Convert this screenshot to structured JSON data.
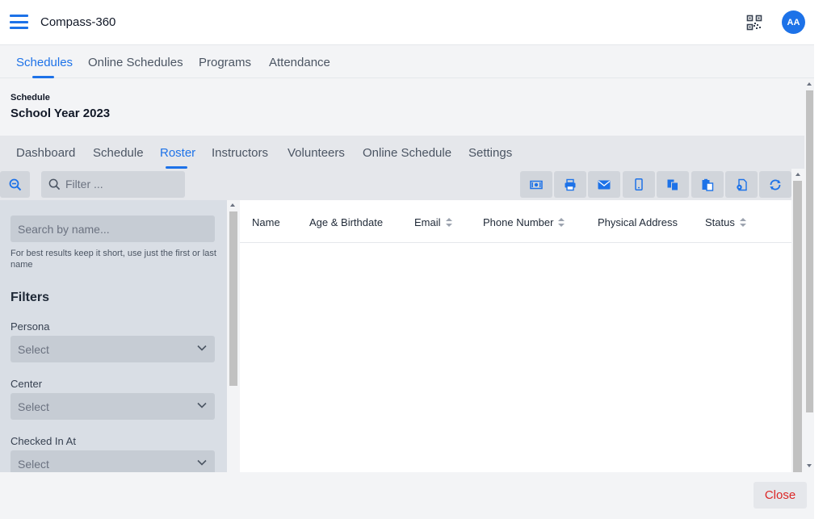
{
  "header": {
    "app_title": "Compass-360",
    "avatar_initials": "AA",
    "accent": "#1d72e8"
  },
  "top_tabs": [
    {
      "label": "Schedules",
      "active": true
    },
    {
      "label": "Online Schedules",
      "active": false
    },
    {
      "label": "Programs",
      "active": false
    },
    {
      "label": "Attendance",
      "active": false
    }
  ],
  "schedule": {
    "label": "Schedule",
    "name": "School Year 2023"
  },
  "sub_tabs": [
    {
      "label": "Dashboard",
      "active": false
    },
    {
      "label": "Schedule",
      "active": false
    },
    {
      "label": "Roster",
      "active": true
    },
    {
      "label": "Instructors",
      "active": false
    },
    {
      "label": "Volunteers",
      "active": false
    },
    {
      "label": "Online Schedule",
      "active": false
    },
    {
      "label": "Settings",
      "active": false
    }
  ],
  "toolbar": {
    "filter_placeholder": "Filter ...",
    "icons": [
      "money-icon",
      "print-icon",
      "email-icon",
      "mobile-icon",
      "copy-icon",
      "paste-icon",
      "file-settings-icon",
      "refresh-icon"
    ]
  },
  "left_panel": {
    "search_placeholder": "Search by name...",
    "search_hint": "For best results keep it short, use just the first or last name",
    "filters_heading": "Filters",
    "filters": [
      {
        "label": "Persona",
        "value": "Select"
      },
      {
        "label": "Center",
        "value": "Select"
      },
      {
        "label": "Checked In At",
        "value": "Select"
      }
    ]
  },
  "table": {
    "columns": [
      {
        "label": "Name",
        "sortable": false
      },
      {
        "label": "Age & Birthdate",
        "sortable": false
      },
      {
        "label": "Email",
        "sortable": true
      },
      {
        "label": "Phone Number",
        "sortable": true
      },
      {
        "label": "Physical Address",
        "sortable": false
      },
      {
        "label": "Status",
        "sortable": true
      }
    ],
    "rows": []
  },
  "footer": {
    "close_label": "Close"
  }
}
